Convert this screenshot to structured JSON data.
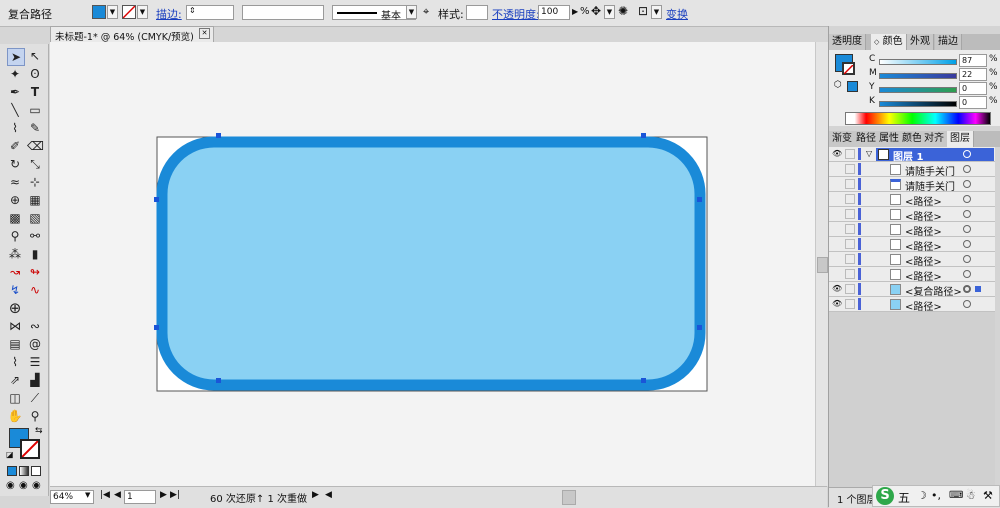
{
  "control_bar": {
    "selection_label": "复合路径",
    "stroke_label": "描边:",
    "stroke_weight": "",
    "brush_label": "基本",
    "style_label": "样式:",
    "opacity_label": "不透明度:",
    "opacity_value": "100",
    "opacity_unit": "%",
    "transform_label": "变换",
    "fill_color": "#1a8ad8"
  },
  "document": {
    "tab_title": "未标题-1* @ 64% (CMYK/预览)",
    "artboard_color": "#ffffff",
    "shape_fill": "#8ad1f3",
    "shape_stroke": "#1a8ad8"
  },
  "status_bar": {
    "zoom": "64%",
    "page": "1",
    "status_text": "60 次还原↑ 1 次重做"
  },
  "panels": {
    "top_tabs": [
      "透明度",
      "颜色",
      "外观",
      "描边"
    ],
    "active_top_tab": "颜色",
    "color": {
      "channels": [
        {
          "label": "C",
          "value": "87",
          "unit": "%"
        },
        {
          "label": "M",
          "value": "22",
          "unit": "%"
        },
        {
          "label": "Y",
          "value": "0",
          "unit": "%"
        },
        {
          "label": "K",
          "value": "0",
          "unit": "%"
        }
      ]
    },
    "bottom_tabs": [
      "渐变",
      "路径",
      "属性",
      "颜色",
      "对齐",
      "图层"
    ],
    "active_bottom_tab": "图层",
    "layers": {
      "top_layer": "图层 1",
      "items": [
        "请随手关门",
        "请随手关门",
        "<路径>",
        "<路径>",
        "<路径>",
        "<路径>",
        "<路径>",
        "<路径>",
        "<复合路径>",
        "<路径>"
      ],
      "footer": "1 个图层"
    }
  },
  "taskbar": {
    "ime_label": "五"
  }
}
